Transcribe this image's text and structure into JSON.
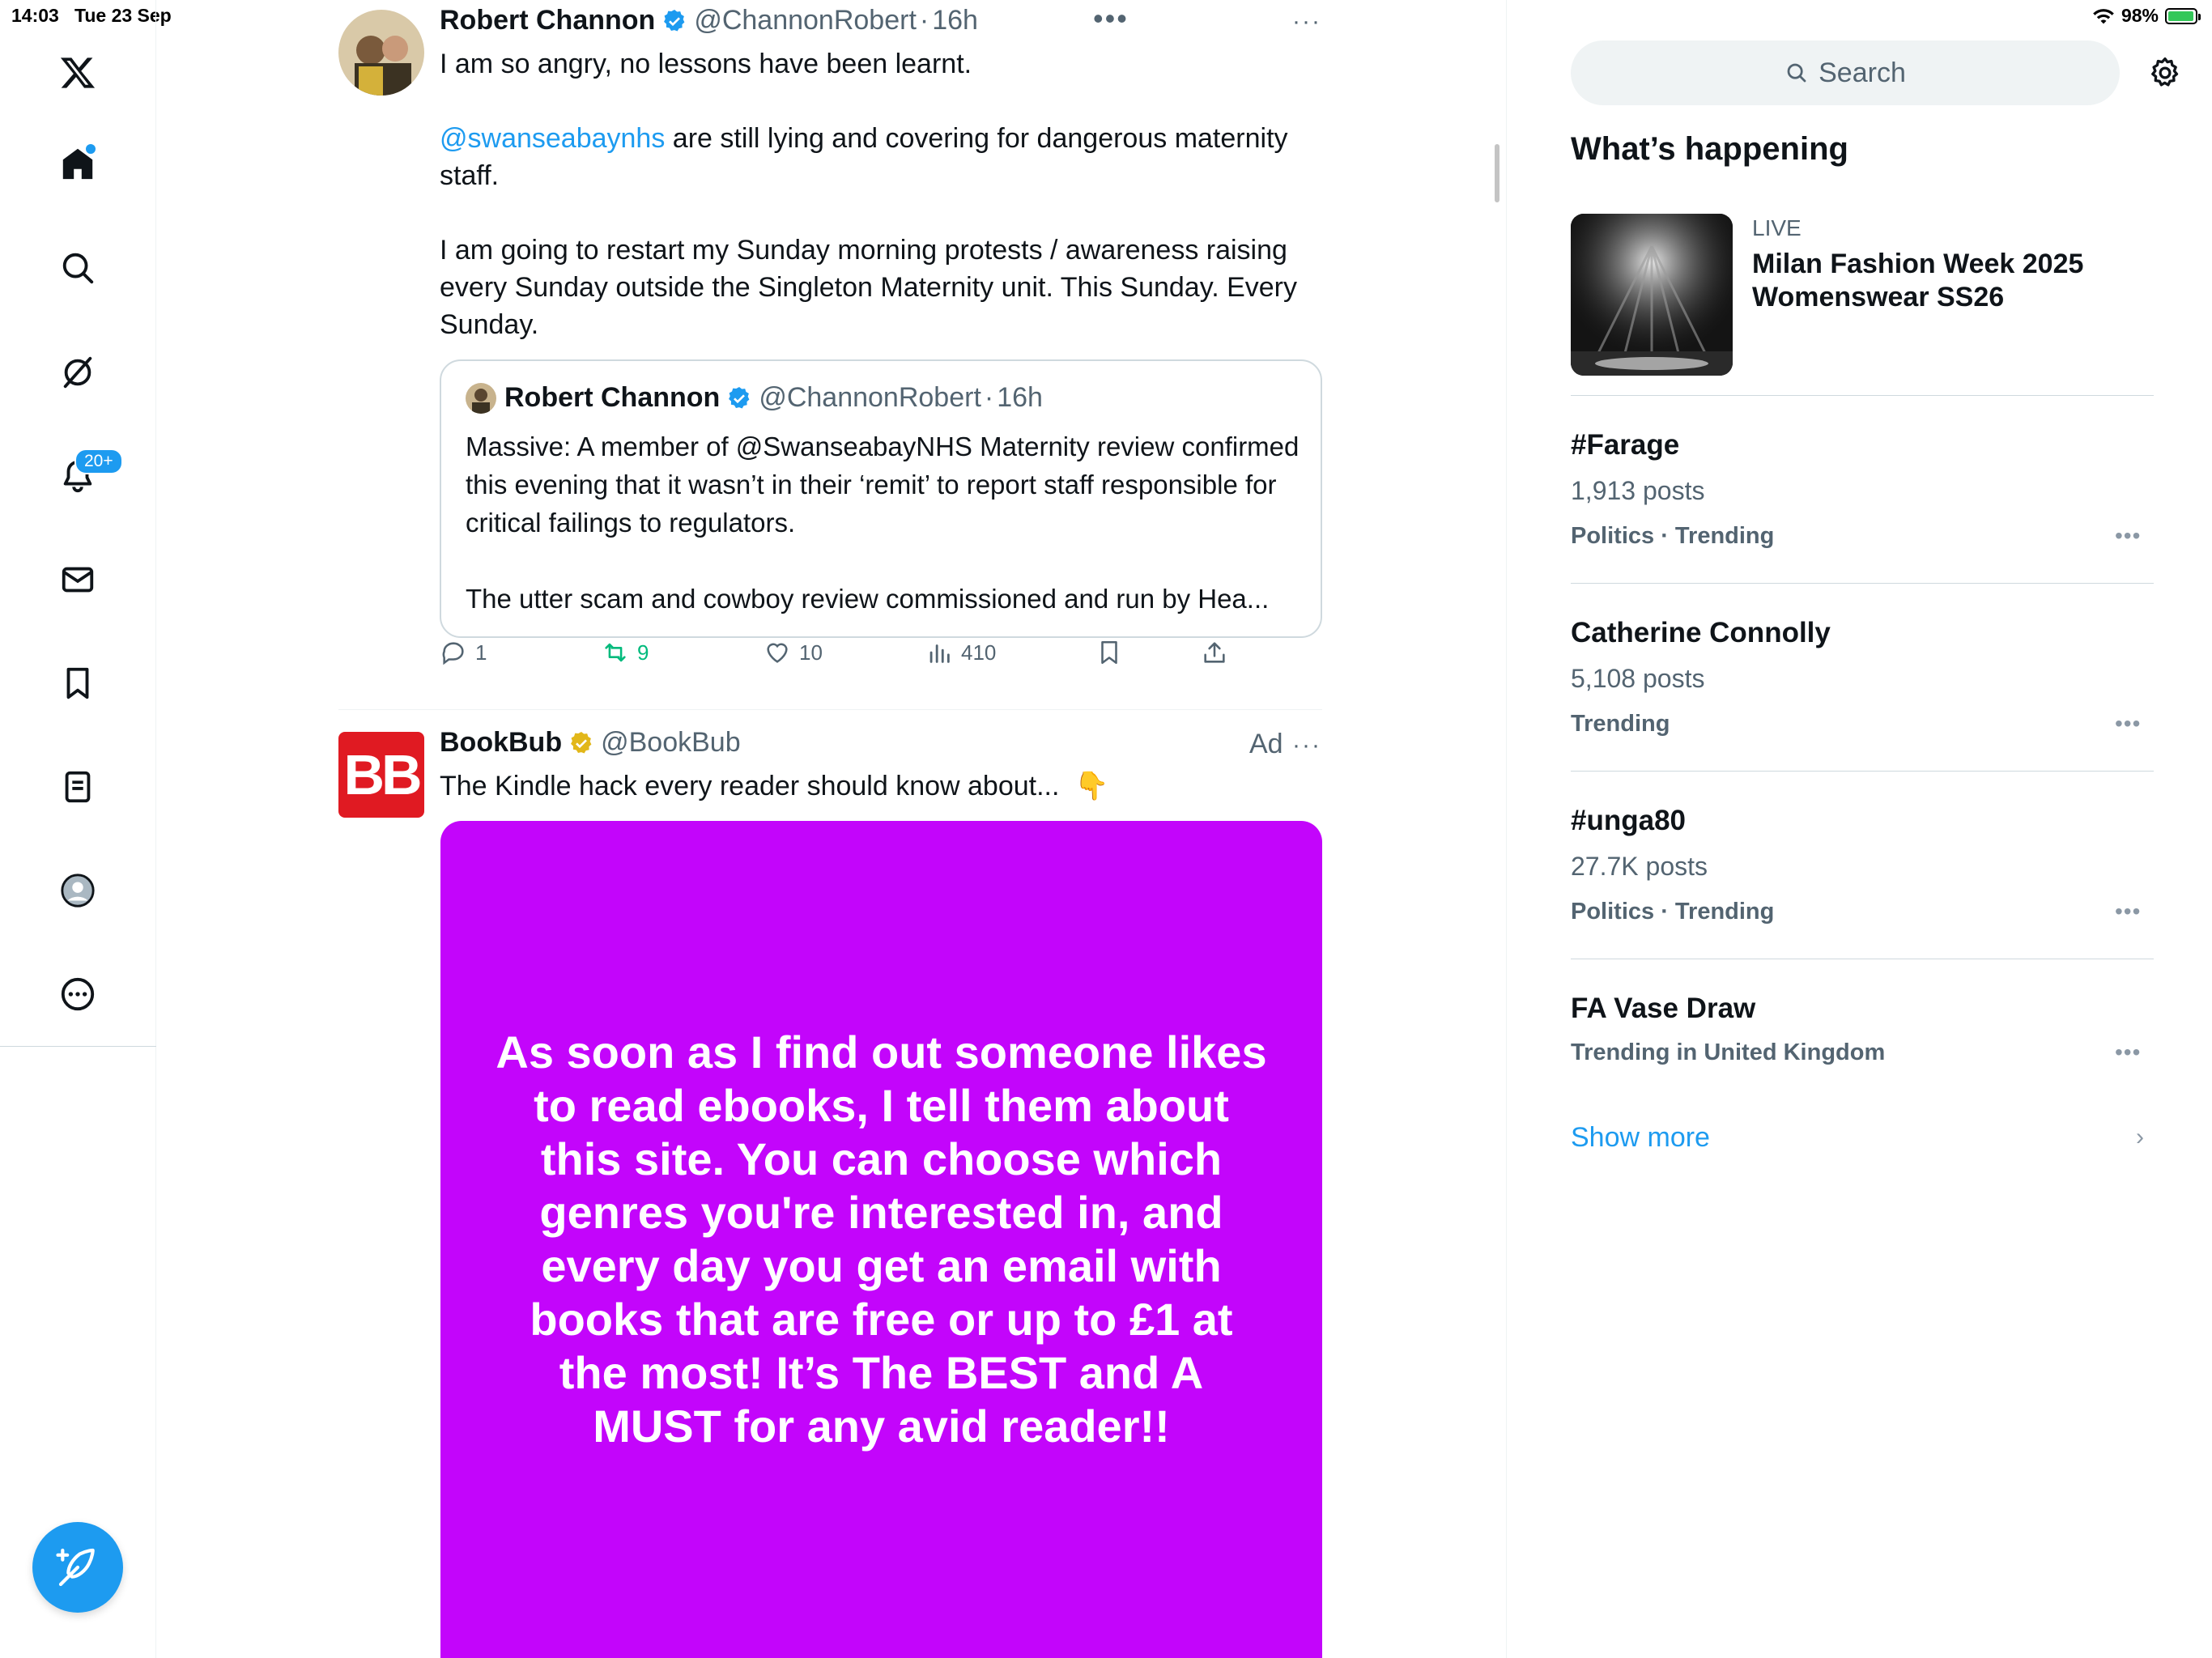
{
  "status_bar": {
    "time": "14:03",
    "date": "Tue 23 Sep",
    "battery": "98%",
    "battery_level": 0.98
  },
  "left_nav": {
    "items": [
      {
        "name": "home",
        "icon": "home-icon",
        "has_dot": true
      },
      {
        "name": "explore",
        "icon": "search-icon"
      },
      {
        "name": "grok",
        "icon": "grok-icon"
      },
      {
        "name": "notifications",
        "icon": "bell-icon",
        "badge": "20+"
      },
      {
        "name": "messages",
        "icon": "envelope-icon"
      },
      {
        "name": "bookmarks",
        "icon": "bookmark-icon"
      },
      {
        "name": "lists",
        "icon": "list-icon"
      },
      {
        "name": "profile",
        "icon": "profile-icon"
      },
      {
        "name": "more",
        "icon": "more-circle-icon"
      }
    ],
    "notification_badge": "20+",
    "compose_icon": "compose-feather-icon"
  },
  "tweet1": {
    "name": "Robert Channon",
    "handle": "@ChannonRobert",
    "time": "16h",
    "text_line1": "I am so angry, no lessons have been learnt.",
    "mention": "@swanseabaynhs",
    "text_after_mention": " are still lying and covering for dangerous maternity staff.",
    "text_para3": "I am going to restart my Sunday morning protests / awareness raising every Sunday outside the Singleton Maternity unit. This Sunday. Every Sunday.",
    "quote": {
      "name": "Robert Channon",
      "handle": "@ChannonRobert",
      "time": "16h",
      "text": "Massive: A member of @SwanseabayNHS Maternity review confirmed this evening that it wasn’t in their ‘remit’ to report staff responsible for critical failings to regulators.\n\nThe utter scam and cowboy review commissioned and run by Hea..."
    },
    "stats": {
      "replies": "1",
      "reposts": "9",
      "likes": "10",
      "views": "410"
    }
  },
  "tweet2": {
    "name": "BookBub",
    "handle": "@BookBub",
    "logo_text": "BB",
    "ad_label": "Ad",
    "text": "The Kindle hack every reader should know about...",
    "emoji": "👇",
    "ad_image_text": "As soon as I find out someone likes to read ebooks, I tell them about this site. You can choose which genres you're interested in, and every day you get an email with books that are free or up to £1 at the most! It’s The BEST and A MUST for any avid reader!!"
  },
  "sidebar": {
    "search_placeholder": "Search",
    "title": "What’s happening",
    "live": {
      "label": "LIVE",
      "title": "Milan Fashion Week 2025 Womenswear SS26"
    },
    "trends": [
      {
        "title": "#Farage",
        "count": "1,913 posts",
        "meta": "Politics · Trending"
      },
      {
        "title": "Catherine Connolly",
        "count": "5,108 posts",
        "meta": "Trending"
      },
      {
        "title": "#unga80",
        "count": "27.7K posts",
        "meta": "Politics · Trending"
      },
      {
        "title": "FA Vase Draw",
        "count": "",
        "meta": "Trending in United Kingdom"
      }
    ],
    "show_more": "Show more"
  },
  "colors": {
    "accent": "#1d9bf0",
    "repost_green": "#00ba7c",
    "ad_background": "#c305fb",
    "bookbub_red": "#e01a22",
    "muted_text": "#536471"
  }
}
